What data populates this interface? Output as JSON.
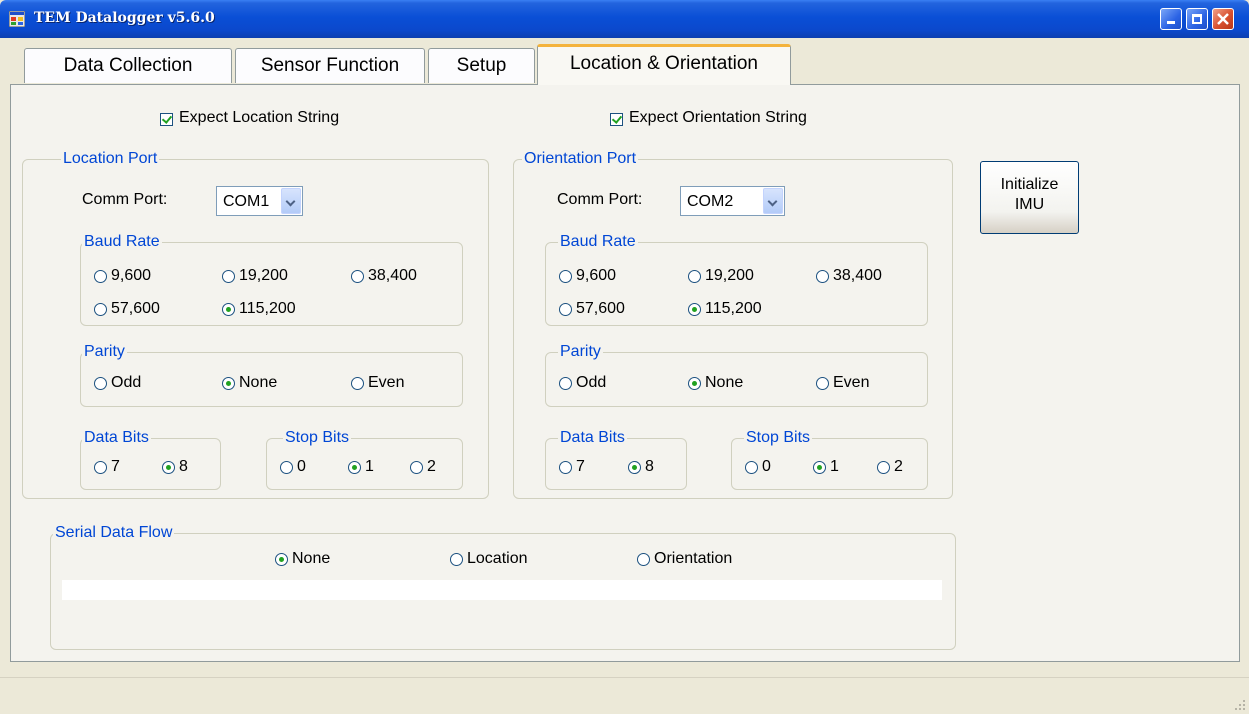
{
  "window": {
    "title": "TEM Datalogger v5.6.0"
  },
  "tabs": [
    {
      "label": "Data Collection"
    },
    {
      "label": "Sensor Function"
    },
    {
      "label": "Setup"
    },
    {
      "label": "Location & Orientation",
      "selected": true
    }
  ],
  "location": {
    "expect_label": "Expect Location String",
    "expect_checked": true,
    "group_title": "Location Port",
    "comm_port_label": "Comm Port:",
    "comm_port_value": "COM1",
    "baud_title": "Baud Rate",
    "baud_options": [
      "9,600",
      "19,200",
      "38,400",
      "57,600",
      "115,200"
    ],
    "baud_selected": "115,200",
    "parity_title": "Parity",
    "parity_options": [
      "Odd",
      "None",
      "Even"
    ],
    "parity_selected": "None",
    "data_bits_title": "Data Bits",
    "data_bits_options": [
      "7",
      "8"
    ],
    "data_bits_selected": "8",
    "stop_bits_title": "Stop Bits",
    "stop_bits_options": [
      "0",
      "1",
      "2"
    ],
    "stop_bits_selected": "1"
  },
  "orientation": {
    "expect_label": "Expect Orientation String",
    "expect_checked": true,
    "group_title": "Orientation Port",
    "comm_port_label": "Comm Port:",
    "comm_port_value": "COM2",
    "baud_title": "Baud Rate",
    "baud_options": [
      "9,600",
      "19,200",
      "38,400",
      "57,600",
      "115,200"
    ],
    "baud_selected": "115,200",
    "parity_title": "Parity",
    "parity_options": [
      "Odd",
      "None",
      "Even"
    ],
    "parity_selected": "None",
    "data_bits_title": "Data Bits",
    "data_bits_options": [
      "7",
      "8"
    ],
    "data_bits_selected": "8",
    "stop_bits_title": "Stop Bits",
    "stop_bits_options": [
      "0",
      "1",
      "2"
    ],
    "stop_bits_selected": "1"
  },
  "initialize_button": {
    "line1": "Initialize",
    "line2": "IMU"
  },
  "serial_flow": {
    "title": "Serial Data Flow",
    "options": [
      "None",
      "Location",
      "Orientation"
    ],
    "selected": "None"
  },
  "icons": {
    "app": "app-window-icon",
    "minimize": "minimize-icon",
    "maximize": "maximize-icon",
    "close": "close-icon",
    "resize": "resize-grip-icon"
  },
  "colors": {
    "title_bar": "#0a4fd6",
    "group_title": "#0046d5",
    "panel_bg": "#f4f3ee",
    "active_tab_accent": "#f4b33c",
    "radio_dot": "#21a121"
  }
}
